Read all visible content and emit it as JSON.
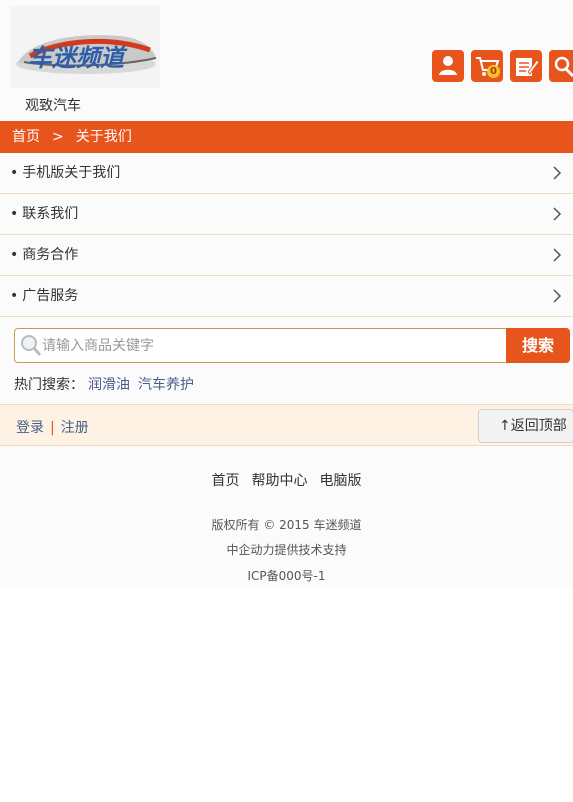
{
  "header": {
    "logo_text": "车迷频道",
    "site_name": "观致汽车",
    "cart_count": "0",
    "icons": [
      "user-icon",
      "cart-icon",
      "edit-icon",
      "search-icon"
    ],
    "accent_color": "#e8551c"
  },
  "breadcrumb": {
    "home": "首页",
    "separator": ">",
    "current": "关于我们"
  },
  "menu": {
    "bullet": "•",
    "items": [
      {
        "label": "手机版关于我们"
      },
      {
        "label": "联系我们"
      },
      {
        "label": "商务合作"
      },
      {
        "label": "广告服务"
      }
    ]
  },
  "search": {
    "placeholder": "请输入商品关键字",
    "button_label": "搜索"
  },
  "hot_search": {
    "label": "热门搜索：",
    "terms": [
      "润滑油",
      "汽车养护"
    ]
  },
  "account": {
    "login": "登录",
    "separator": "|",
    "register": "注册",
    "back_to_top": "↑返回顶部"
  },
  "footer": {
    "links": [
      "首页",
      "帮助中心",
      "电脑版"
    ],
    "copyright": "版权所有 © 2015 车迷频道",
    "support": "中企动力提供技术支持",
    "icp": "ICP备000号-1"
  }
}
